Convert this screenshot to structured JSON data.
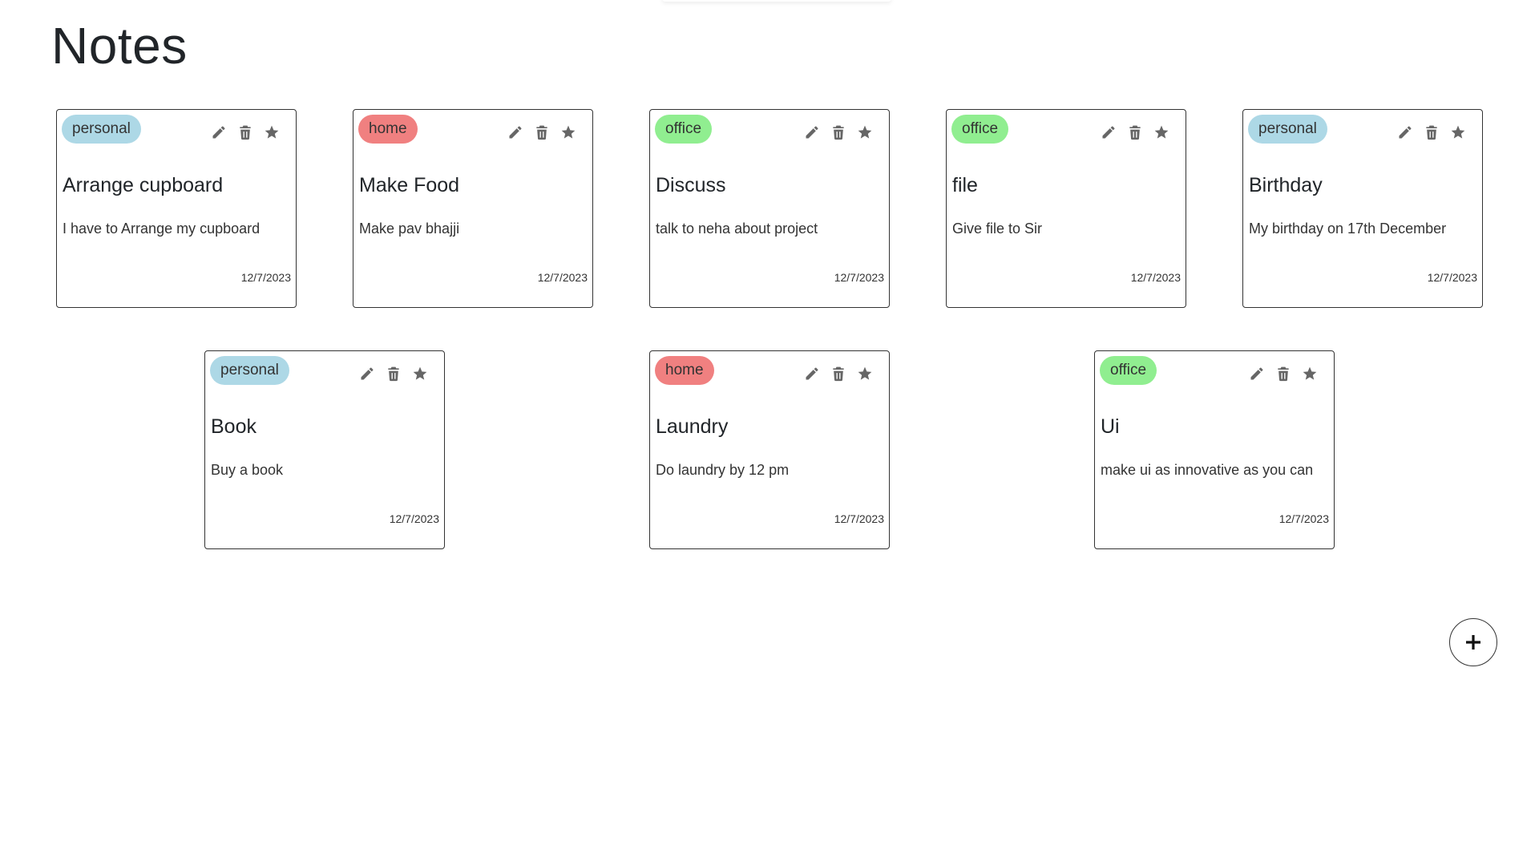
{
  "page": {
    "title": "Notes"
  },
  "colors": {
    "tag_personal": "#add8e6",
    "tag_home": "#f08080",
    "tag_office": "#90ee90",
    "icon": "#666666",
    "card_border": "#333333"
  },
  "icons": {
    "edit": "pencil-icon",
    "delete": "trash-icon",
    "favorite": "star-icon",
    "add": "plus-icon"
  },
  "notes": [
    {
      "tag": "personal",
      "title": "Arrange cupboard",
      "text": "I have to Arrange my cupboard",
      "date": "12/7/2023"
    },
    {
      "tag": "home",
      "title": "Make Food",
      "text": "Make pav bhajji",
      "date": "12/7/2023"
    },
    {
      "tag": "office",
      "title": "Discuss",
      "text": "talk to neha about project",
      "date": "12/7/2023"
    },
    {
      "tag": "office",
      "title": "file",
      "text": "Give file to Sir",
      "date": "12/7/2023"
    },
    {
      "tag": "personal",
      "title": "Birthday",
      "text": "My birthday on 17th December",
      "date": "12/7/2023"
    },
    {
      "tag": "personal",
      "title": "Book",
      "text": "Buy a book",
      "date": "12/7/2023"
    },
    {
      "tag": "home",
      "title": "Laundry",
      "text": "Do laundry by 12 pm",
      "date": "12/7/2023"
    },
    {
      "tag": "office",
      "title": "Ui",
      "text": "make ui as innovative as you can",
      "date": "12/7/2023"
    }
  ]
}
